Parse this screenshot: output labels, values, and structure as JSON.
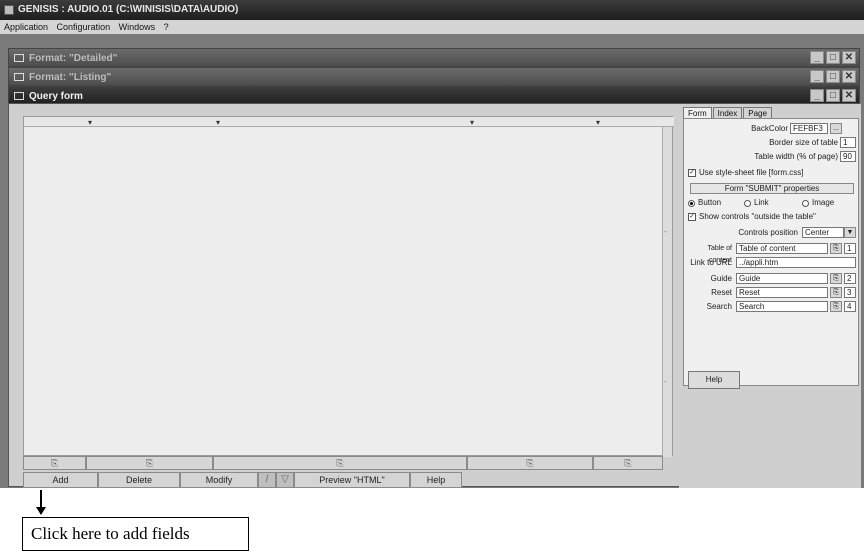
{
  "app": {
    "title": "GENISIS : AUDIO.01 (C:\\WINISIS\\DATA\\AUDIO)",
    "menu": [
      "Application",
      "Configuration",
      "Windows",
      "?"
    ]
  },
  "windows": [
    {
      "title": "Format: \"Detailed\""
    },
    {
      "title": "Format: \"Listing\""
    },
    {
      "title": "Query form"
    }
  ],
  "window_controls": [
    "_",
    "□",
    "✕"
  ],
  "design": {
    "column_markers": [
      "▾",
      "▾",
      "▾",
      "▾"
    ],
    "scroll_markers": [
      "-",
      "-"
    ],
    "column_button_icon": "⎘"
  },
  "bottom_bar": {
    "add": "Add",
    "delete": "Delete",
    "modify": "Modify",
    "preview": "Preview \"HTML\"",
    "help": "Help",
    "icon1": "/",
    "icon2": "▽"
  },
  "props": {
    "tabs": [
      "Form",
      "Index",
      "Page"
    ],
    "backcolor_label": "BackColor",
    "backcolor_value": "FEFBF3",
    "border_label": "Border size of table",
    "border_value": "1",
    "width_label": "Table width (% of page)",
    "width_value": "90",
    "use_css_label": "Use style-sheet file [form.css]",
    "submit_section": "Form \"SUBMIT\" properties",
    "radio_button": "Button",
    "radio_link": "Link",
    "radio_image": "Image",
    "show_controls_label": "Show controls \"outside the table\"",
    "position_label": "Controls position",
    "position_value": "Center",
    "toc_label": "Table of content",
    "toc_value": "Table of content",
    "toc_num": "1",
    "url_label": "Link to URL",
    "url_value": "../appli.htm",
    "guide_label": "Guide",
    "guide_value": "Guide",
    "guide_num": "2",
    "reset_label": "Reset",
    "reset_value": "Reset",
    "reset_num": "3",
    "search_label": "Search",
    "search_value": "Search",
    "search_num": "4",
    "help": "Help",
    "ellipsis": "...",
    "dropdown": "▼",
    "field_button": "⎘",
    "check": "✓"
  },
  "callout": {
    "text": "Click here to add fields"
  }
}
